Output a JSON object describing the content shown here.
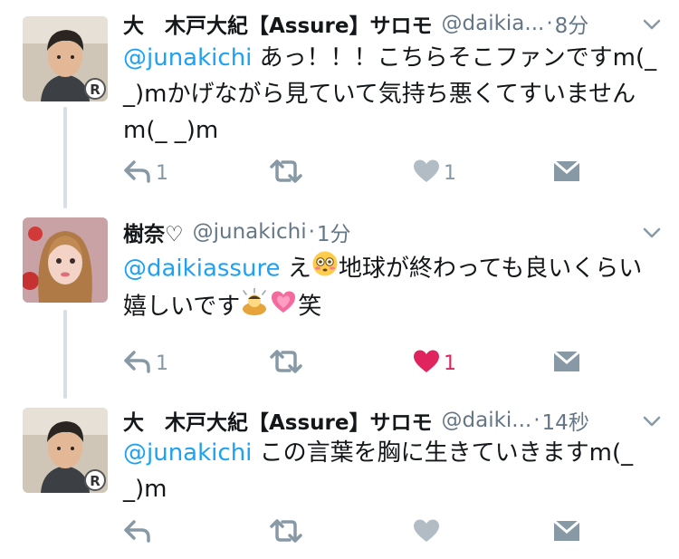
{
  "tweets": [
    {
      "name": "大　木戸大紀【Assure】サロモ",
      "handle": "@daikia...",
      "dot": "·",
      "time": "8分",
      "mention": "@junakichi",
      "text": " あっ！！！こちらそこファンですm(_ _)mかげながら見ていて気持ち悪くてすいませんm(_ _)m",
      "replies": "1",
      "retweets": "",
      "likes": "1",
      "liked": false
    },
    {
      "name": "樹奈♡",
      "handle": "@junakichi",
      "dot": "·",
      "time": "1分",
      "mention": "@daikiassure",
      "text_a": " え",
      "text_b": "地球が終わっても良いくらい嬉しいです",
      "text_c": "笑",
      "replies": "1",
      "retweets": "",
      "likes": "1",
      "liked": true
    },
    {
      "name": "大　木戸大紀【Assure】サロモ",
      "handle": "@daiki...",
      "dot": "·",
      "time": "14秒",
      "mention": "@junakichi",
      "text": " この言葉を胸に生きていきますm(_ _)m",
      "replies": "",
      "retweets": "",
      "likes": "",
      "liked": false
    }
  ],
  "colors": {
    "link": "#1da1f2",
    "icon": "#8899a6",
    "like_active": "#e0245e",
    "thread_line": "#d8dee3"
  },
  "icons": [
    "reply-icon",
    "retweet-icon",
    "like-icon",
    "dm-icon",
    "chevron-down-icon",
    "flushed-face-emoji",
    "bowing-person-emoji",
    "growing-heart-emoji"
  ]
}
